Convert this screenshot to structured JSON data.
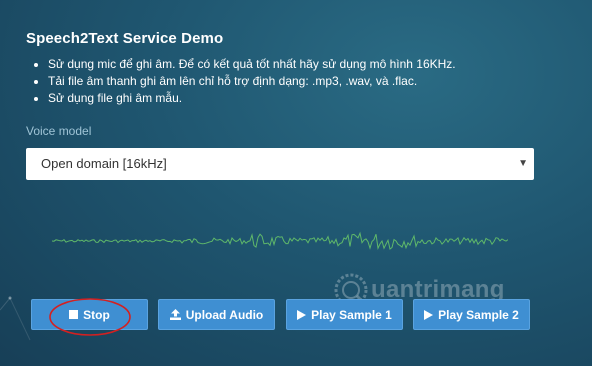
{
  "header": {
    "title": "Speech2Text Service Demo",
    "bullets": [
      "Sử dụng mic để ghi âm. Để có kết quả tốt nhất hãy sử dụng mô hình 16KHz.",
      "Tải file âm thanh ghi âm lên chỉ hỗ trợ định dạng: .mp3, .wav, và .flac.",
      "Sử dụng file ghi âm mẫu."
    ]
  },
  "voice_model": {
    "label": "Voice model",
    "selected": "Open domain [16kHz]",
    "arrow": "▼"
  },
  "buttons": {
    "stop": "Stop",
    "upload": "Upload Audio",
    "sample1": "Play Sample 1",
    "sample2": "Play Sample 2"
  },
  "watermark": {
    "text": "uantrimang"
  },
  "colors": {
    "background": "#1f5670",
    "button": "#3f8fd2",
    "waveform": "#5fb86a",
    "annotation": "#d42020"
  },
  "icons": {
    "stop": "stop-square-icon",
    "upload": "upload-icon",
    "play": "play-icon",
    "dropdown": "caret-down-icon"
  }
}
